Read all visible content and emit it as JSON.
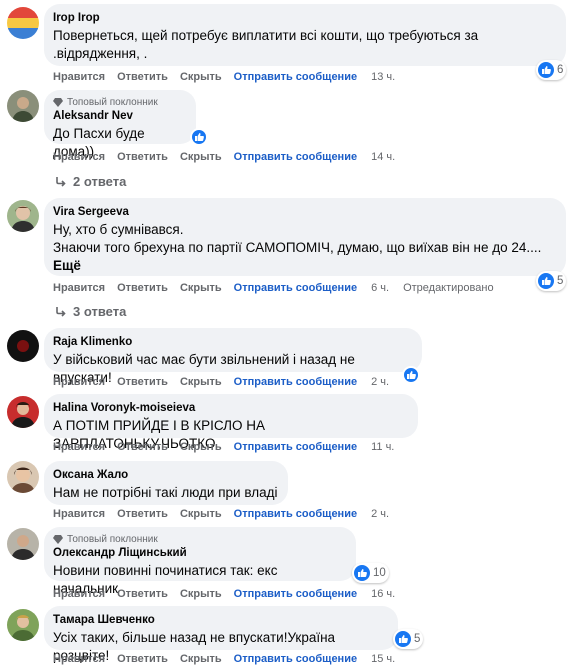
{
  "colors": {
    "like_blue": "#1877f2",
    "bubble": "#f0f2f5",
    "meta_gray": "#65676b",
    "send_blue": "#1c5ec7"
  },
  "actions": {
    "like": "Нравится",
    "reply": "Ответить",
    "hide": "Скрыть",
    "send": "Отправить сообщение"
  },
  "comments": [
    {
      "author": "Irop Irop",
      "lines": [
        "Повернеться, щей потребує виплатити всі кошти, що требуються за",
        ".відрядження, ."
      ],
      "time": "13 ч.",
      "reactions": "6"
    },
    {
      "badge": "Топовый поклонник",
      "author": "Aleksandr Nev",
      "lines": [
        "До Пасхи буде дома))"
      ],
      "time": "14 ч.",
      "replies": "2 ответа"
    },
    {
      "author": "Vira Sergeeva",
      "lines": [
        "Ну, хто б сумнівався.",
        "Знаючи того брехуна по партії САМОПОМІЧ, думаю, що виїхав він не до 24...."
      ],
      "more": "Ещё",
      "time": "6 ч.",
      "edited": "Отредактировано",
      "reactions": "5",
      "replies": "3 ответа"
    },
    {
      "author": "Raja Klimenko",
      "lines": [
        "У військовий час має бути звільнений і назад не впускати!"
      ],
      "time": "2 ч."
    },
    {
      "author": "Halina Voronyk-moiseieva",
      "lines": [
        "А ПОТІМ ПРИЙДЕ І В КРІСЛО НА ЗАРПЛАТОНЬКУ,ЧЬОТКО"
      ],
      "time": "11 ч."
    },
    {
      "author": "Оксана Жало",
      "lines": [
        "Нам не потрібні такі люди при владі"
      ],
      "time": "2 ч."
    },
    {
      "badge": "Топовый поклонник",
      "author": "Олександр Ліщинський",
      "lines": [
        "Новини повинні починатися так: екс начальник"
      ],
      "time": "16 ч.",
      "reactions": "10"
    },
    {
      "author": "Тамара Шевченко",
      "lines": [
        "Усіх таких, більше назад не впускати!Україна розцвіте!"
      ],
      "time": "15 ч.",
      "reactions": "5"
    }
  ]
}
